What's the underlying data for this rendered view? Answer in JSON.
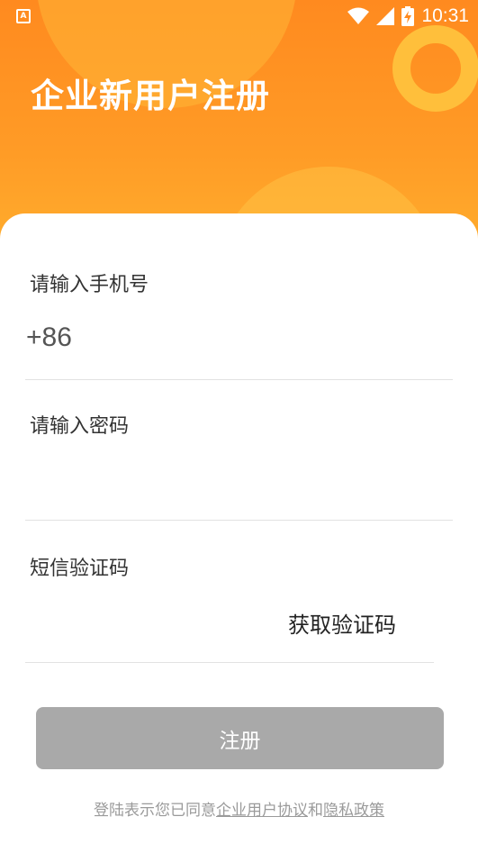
{
  "status_bar": {
    "app_icon_glyph": "A",
    "time": "10:31",
    "icons": [
      "wifi-icon",
      "signal-icon",
      "battery-charging-icon"
    ]
  },
  "header": {
    "title": "企业新用户注册"
  },
  "form": {
    "phone": {
      "label": "请输入手机号",
      "prefix": "+86"
    },
    "password": {
      "label": "请输入密码"
    },
    "sms_code": {
      "label": "短信验证码",
      "get_code_label": "获取验证码"
    },
    "submit_label": "注册"
  },
  "agreement": {
    "prefix": "登陆表示您已同意",
    "user_agreement_link": "企业用户协议",
    "conjunction": "和",
    "privacy_link": "隐私政策"
  },
  "colors": {
    "header_orange": "#ff8a1f",
    "submit_disabled": "#a9a9a9"
  }
}
